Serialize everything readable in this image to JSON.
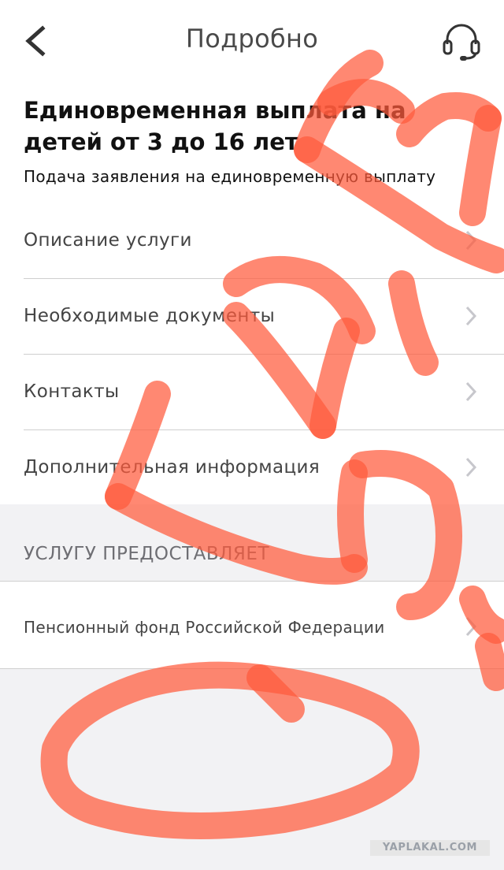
{
  "nav": {
    "title": "Подробно",
    "back_icon": "chevron-left-icon",
    "support_icon": "headset-icon"
  },
  "service": {
    "title": "Единовременная выплата на детей от 3 до 16 лет",
    "subtitle": "Подача заявления на единовременную выплату"
  },
  "menu": {
    "items": [
      {
        "label": "Описание услуги"
      },
      {
        "label": "Необходимые документы"
      },
      {
        "label": "Контакты"
      },
      {
        "label": "Дополнительная информация"
      }
    ]
  },
  "provider_section": {
    "header": "УСЛУГУ ПРЕДОСТАВЛЯЕТ",
    "provider_label": "Пенсионный фонд Российской Федерации"
  },
  "watermark": "YAPLAKAL.COM",
  "colors": {
    "scribble": "#ff5a3c",
    "background_gray": "#f2f2f4",
    "chevron": "#c7c7cc"
  }
}
